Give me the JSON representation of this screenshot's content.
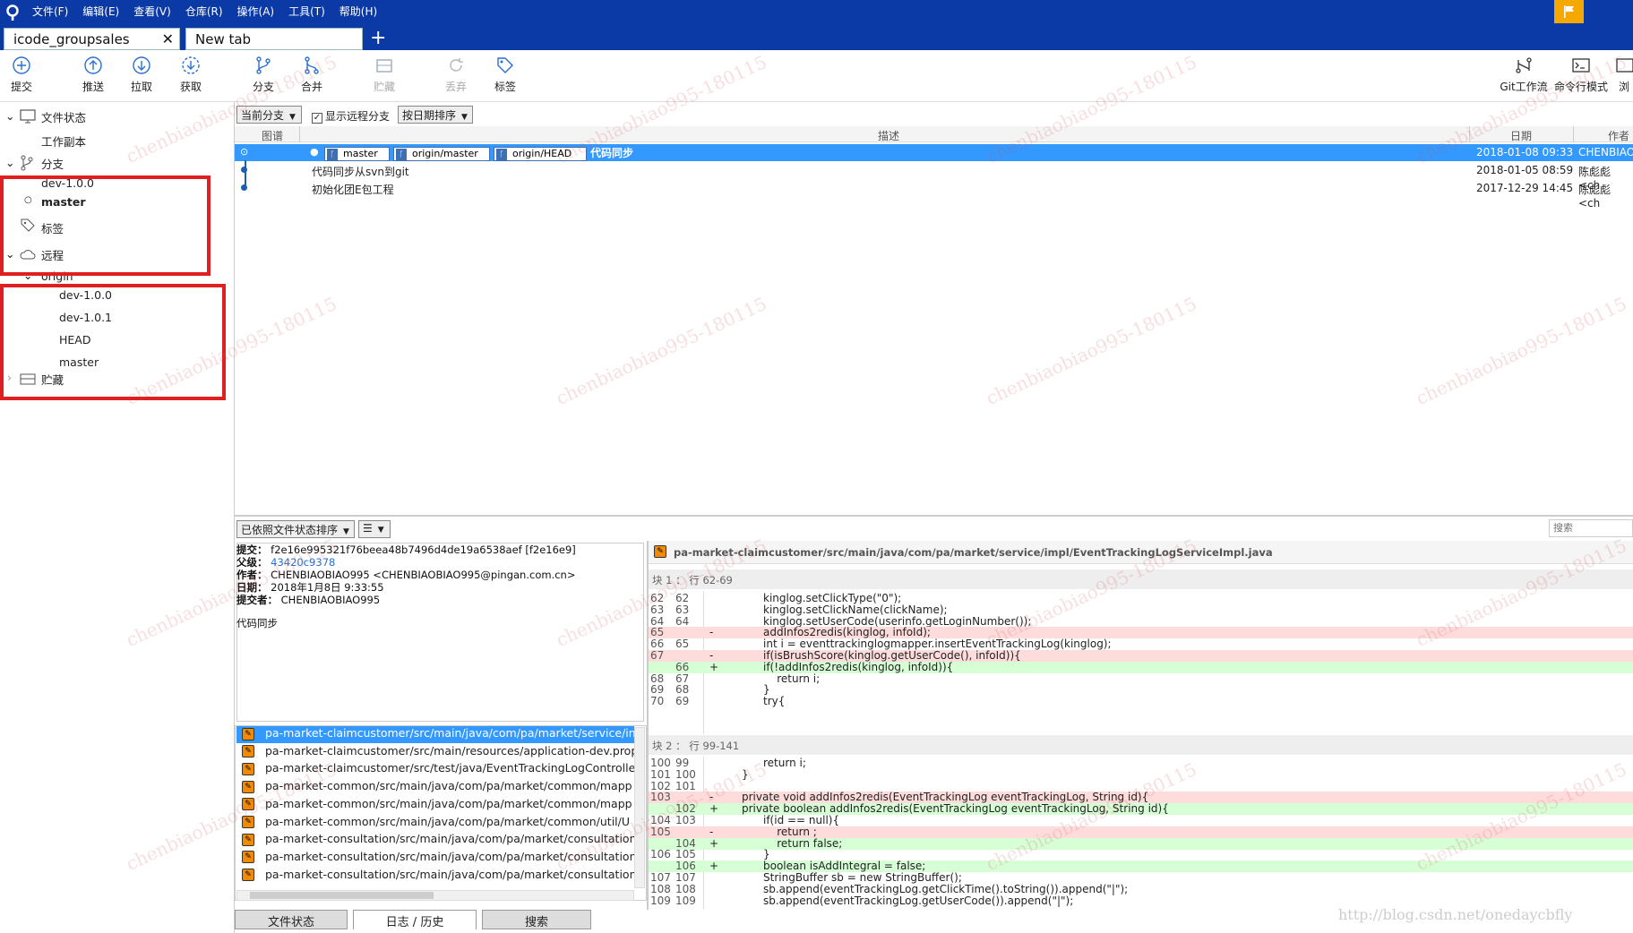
{
  "menu": [
    "文件(F)",
    "编辑(E)",
    "查看(V)",
    "仓库(R)",
    "操作(A)",
    "工具(T)",
    "帮助(H)"
  ],
  "tabs": [
    {
      "label": "icode_groupsales"
    },
    {
      "label": "New tab"
    }
  ],
  "toolbar": {
    "commit": "提交",
    "push": "推送",
    "pull": "拉取",
    "fetch": "获取",
    "branch": "分支",
    "merge": "合并",
    "stash": "贮藏",
    "discard": "丢弃",
    "tag": "标签",
    "gitflow": "Git工作流",
    "terminal": "命令行模式",
    "browse": "浏"
  },
  "sidebar": {
    "file_status": "文件状态",
    "working_copy": "工作副本",
    "branches": "分支",
    "branch_items": [
      "dev-1.0.0",
      "master"
    ],
    "tags": "标签",
    "remotes": "远程",
    "origin": "origin",
    "remote_items": [
      "dev-1.0.0",
      "dev-1.0.1",
      "HEAD",
      "master"
    ],
    "stashes": "贮藏"
  },
  "filters": {
    "current_branch": "当前分支",
    "show_remote": "显示远程分支",
    "sort_date": "按日期排序"
  },
  "columns": {
    "graph": "图谱",
    "desc": "描述",
    "date": "日期",
    "author": "作者"
  },
  "commits": [
    {
      "tags": [
        "master",
        "origin/master",
        "origin/HEAD"
      ],
      "msg": "代码同步",
      "date": "2018-01-08 09:33",
      "author": "CHENBIAO"
    },
    {
      "tags": [],
      "msg": "代码同步从svn到git",
      "date": "2018-01-05 08:59",
      "author": "陈彪彪 <ch"
    },
    {
      "tags": [],
      "msg": "初始化团E包工程",
      "date": "2017-12-29 14:45",
      "author": "陈彪彪 <ch"
    }
  ],
  "file_sort": "已依照文件状态排序",
  "search_placeholder": "搜索",
  "commit_detail": {
    "commit_label": "提交：",
    "commit": "f2e16e995321f76beea48b7496d4de19a6538aef [f2e16e9]",
    "parent_label": "父级：",
    "parent": "43420c9378",
    "author_label": "作者：",
    "author": "CHENBIAOBIAO995 <CHENBIAOBIAO995@pingan.com.cn>",
    "date_label": "日期：",
    "date": "2018年1月8日 9:33:55",
    "committer_label": "提交者：",
    "committer": "CHENBIAOBIAO995",
    "message": "代码同步"
  },
  "files": [
    "pa-market-claimcustomer/src/main/java/com/pa/market/service/im",
    "pa-market-claimcustomer/src/main/resources/application-dev.prop",
    "pa-market-claimcustomer/src/test/java/EventTrackingLogController",
    "pa-market-common/src/main/java/com/pa/market/common/mapp",
    "pa-market-common/src/main/java/com/pa/market/common/mapp",
    "pa-market-common/src/main/java/com/pa/market/common/util/U",
    "pa-market-consultation/src/main/java/com/pa/market/consultation",
    "pa-market-consultation/src/main/java/com/pa/market/consultation",
    "pa-market-consultation/src/main/java/com/pa/market/consultation"
  ],
  "diff_file": "pa-market-claimcustomer/src/main/java/com/pa/market/service/impl/EventTrackingLogServiceImpl.java",
  "hunk1": "块 1 ： 行 62-69",
  "hunk2": "块 2 ： 行 99-141",
  "hunk1_lines": [
    {
      "a": "62",
      "b": "62",
      "s": "",
      "t": "kinglog.setClickType(\"0\");",
      "k": "ctx"
    },
    {
      "a": "63",
      "b": "63",
      "s": "",
      "t": "kinglog.setClickName(clickName);",
      "k": "ctx"
    },
    {
      "a": "64",
      "b": "64",
      "s": "",
      "t": "kinglog.setUserCode(userinfo.getLoginNumber());",
      "k": "ctx"
    },
    {
      "a": "65",
      "b": "",
      "s": "-",
      "t": "addInfos2redis(kinglog, infoId);",
      "k": "del"
    },
    {
      "a": "66",
      "b": "65",
      "s": "",
      "t": "int i = eventtrackinglogmapper.insertEventTrackingLog(kinglog);",
      "k": "ctx"
    },
    {
      "a": "67",
      "b": "",
      "s": "-",
      "t": "if(isBrushScore(kinglog.getUserCode(), infoId)){",
      "k": "del"
    },
    {
      "a": "",
      "b": "66",
      "s": "+",
      "t": "if(!addInfos2redis(kinglog, infoId)){",
      "k": "add"
    },
    {
      "a": "68",
      "b": "67",
      "s": "",
      "t": "    return i;",
      "k": "ctx"
    },
    {
      "a": "69",
      "b": "68",
      "s": "",
      "t": "}",
      "k": "ctx"
    },
    {
      "a": "70",
      "b": "69",
      "s": "",
      "t": "try{",
      "k": "ctx"
    }
  ],
  "hunk2_lines": [
    {
      "a": "100",
      "b": "99",
      "s": "",
      "t": "return i;",
      "k": "ctx"
    },
    {
      "a": "101",
      "b": "100",
      "s": "",
      "t": "}",
      "k": "ctx",
      "o": -2
    },
    {
      "a": "102",
      "b": "101",
      "s": "",
      "t": "",
      "k": "ctx"
    },
    {
      "a": "103",
      "b": "",
      "s": "-",
      "t": "private void addInfos2redis(EventTrackingLog eventTrackingLog, String id){",
      "k": "del",
      "o": -2
    },
    {
      "a": "",
      "b": "102",
      "s": "+",
      "t": "private boolean addInfos2redis(EventTrackingLog eventTrackingLog, String id){",
      "k": "add",
      "o": -2
    },
    {
      "a": "104",
      "b": "103",
      "s": "",
      "t": "if(id == null){",
      "k": "ctx"
    },
    {
      "a": "105",
      "b": "",
      "s": "-",
      "t": "    return ;",
      "k": "del"
    },
    {
      "a": "",
      "b": "104",
      "s": "+",
      "t": "    return false;",
      "k": "add"
    },
    {
      "a": "106",
      "b": "105",
      "s": "",
      "t": "}",
      "k": "ctx"
    },
    {
      "a": "",
      "b": "106",
      "s": "+",
      "t": "boolean isAddIntegral = false;",
      "k": "add"
    },
    {
      "a": "107",
      "b": "107",
      "s": "",
      "t": "StringBuffer sb = new StringBuffer();",
      "k": "ctx"
    },
    {
      "a": "108",
      "b": "108",
      "s": "",
      "t": "sb.append(eventTrackingLog.getClickTime().toString()).append(\"|\");",
      "k": "ctx"
    },
    {
      "a": "109",
      "b": "109",
      "s": "",
      "t": "sb.append(eventTrackingLog.getUserCode()).append(\"|\");",
      "k": "ctx"
    }
  ],
  "bottom_tabs": [
    "文件状态",
    "日志 / 历史",
    "搜索"
  ],
  "watermark": "chenbiaobiao995-180115",
  "url": "http://blog.csdn.net/onedaycbfly",
  "colors": {
    "titlebar": "#0b3aa6",
    "selection": "#3399ff",
    "highlight_box": "#e02020"
  }
}
